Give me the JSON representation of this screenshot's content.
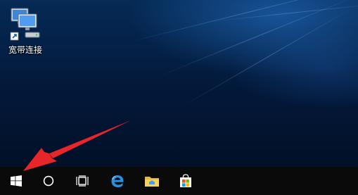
{
  "desktop": {
    "icons": [
      {
        "label": "宽带连接",
        "icon": "network-connection-icon"
      }
    ]
  },
  "taskbar": {
    "buttons": [
      {
        "name": "start-button",
        "icon": "windows-logo-icon"
      },
      {
        "name": "search-button",
        "icon": "cortana-circle-icon"
      },
      {
        "name": "task-view-button",
        "icon": "task-view-icon"
      },
      {
        "name": "edge-button",
        "icon": "edge-browser-icon"
      },
      {
        "name": "file-explorer-button",
        "icon": "folder-icon"
      },
      {
        "name": "store-button",
        "icon": "store-bag-icon"
      }
    ]
  },
  "annotation": {
    "type": "red-arrow",
    "points_to": "start-button",
    "color": "#e8262a"
  },
  "colors": {
    "taskbar": "#0a0a0a",
    "accent_blue": "#1e90ff"
  }
}
